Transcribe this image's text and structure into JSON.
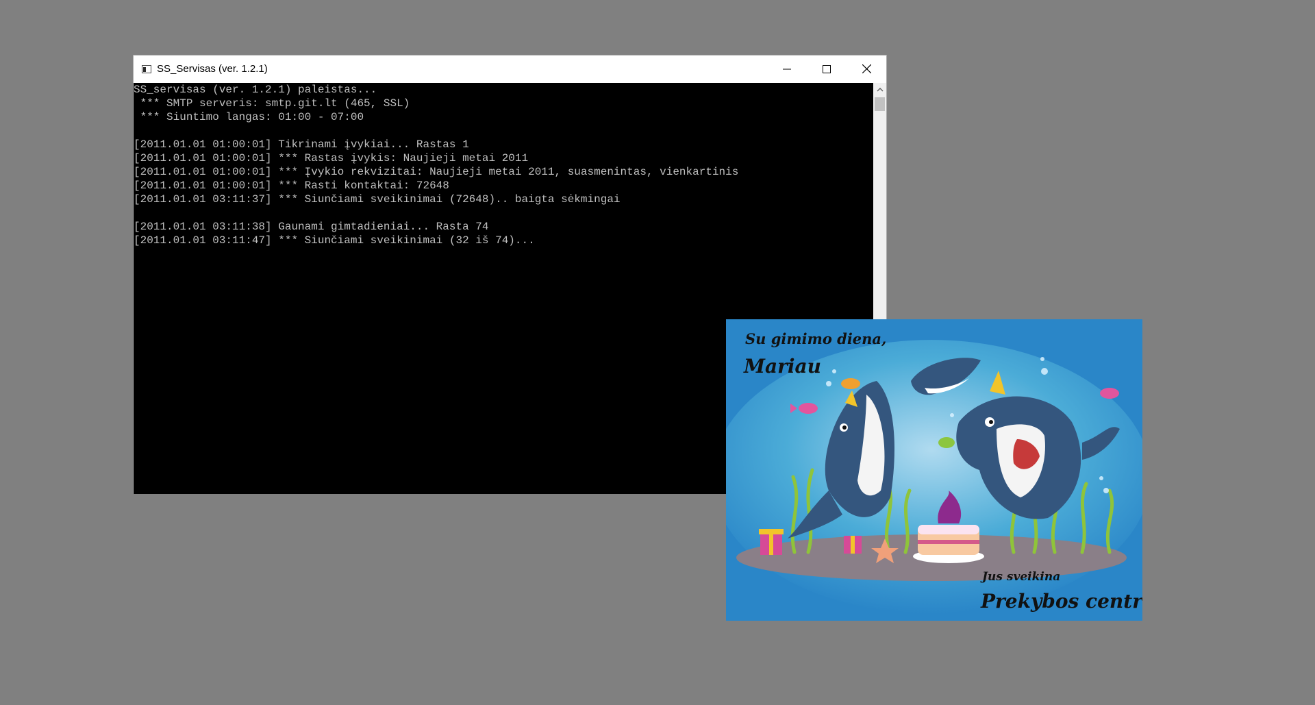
{
  "window": {
    "title": "SS_Servisas (ver. 1.2.1)"
  },
  "console": {
    "lines": [
      "SS_servisas (ver. 1.2.1) paleistas...",
      " *** SMTP serveris: smtp.git.lt (465, SSL)",
      " *** Siuntimo langas: 01:00 - 07:00",
      "",
      "[2011.01.01 01:00:01] Tikrinami įvykiai... Rastas 1",
      "[2011.01.01 01:00:01] *** Rastas įvykis: Naujieji metai 2011",
      "[2011.01.01 01:00:01] *** Įvykio rekvizitai: Naujieji metai 2011, suasmenintas, vienkartinis",
      "[2011.01.01 01:00:01] *** Rasti kontaktai: 72648",
      "[2011.01.01 03:11:37] *** Siunčiami sveikinimai (72648).. baigta sėkmingai",
      "",
      "[2011.01.01 03:11:38] Gaunami gimtadieniai... Rasta 74",
      "[2011.01.01 03:11:47] *** Siunčiami sveikinimai (32 iš 74)..."
    ]
  },
  "card": {
    "greeting_line1": "Su gimimo diena,",
    "greeting_line2": "Mariau",
    "sender_line1": "Jus sveikina",
    "sender_line2": "Prekybos centras"
  },
  "icons": {
    "minimize": "minimize-icon",
    "maximize": "maximize-icon",
    "close": "close-icon",
    "scroll_up": "chevron-up-icon"
  },
  "colors": {
    "desktop": "#808080",
    "console_bg": "#000000",
    "console_text": "#c0c0c0",
    "card_bg": "#2a86c8"
  }
}
